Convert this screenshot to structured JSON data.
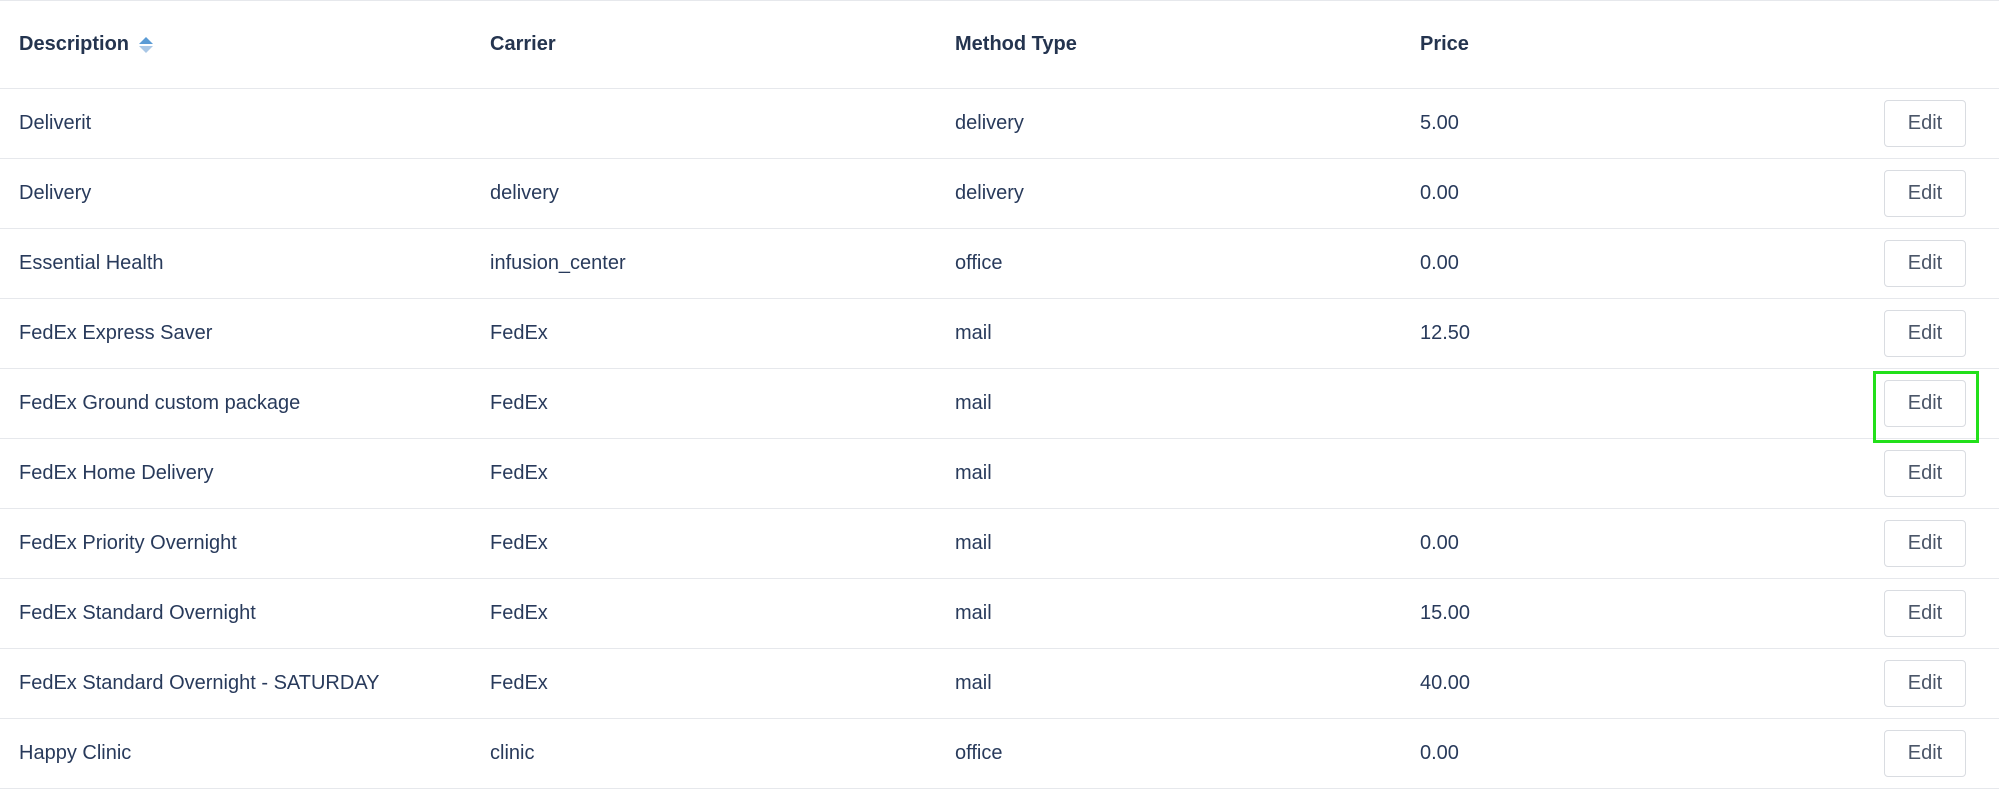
{
  "columns": {
    "description": "Description",
    "carrier": "Carrier",
    "method_type": "Method Type",
    "price": "Price"
  },
  "rows": [
    {
      "description": "Deliverit",
      "carrier": "",
      "method_type": "delivery",
      "price": "5.00",
      "action": "Edit"
    },
    {
      "description": "Delivery",
      "carrier": "delivery",
      "method_type": "delivery",
      "price": "0.00",
      "action": "Edit"
    },
    {
      "description": "Essential Health",
      "carrier": "infusion_center",
      "method_type": "office",
      "price": "0.00",
      "action": "Edit"
    },
    {
      "description": "FedEx Express Saver",
      "carrier": "FedEx",
      "method_type": "mail",
      "price": "12.50",
      "action": "Edit"
    },
    {
      "description": "FedEx Ground custom package",
      "carrier": "FedEx",
      "method_type": "mail",
      "price": "",
      "action": "Edit"
    },
    {
      "description": "FedEx Home Delivery",
      "carrier": "FedEx",
      "method_type": "mail",
      "price": "",
      "action": "Edit"
    },
    {
      "description": "FedEx Priority Overnight",
      "carrier": "FedEx",
      "method_type": "mail",
      "price": "0.00",
      "action": "Edit"
    },
    {
      "description": "FedEx Standard Overnight",
      "carrier": "FedEx",
      "method_type": "mail",
      "price": "15.00",
      "action": "Edit"
    },
    {
      "description": "FedEx Standard Overnight - SATURDAY",
      "carrier": "FedEx",
      "method_type": "mail",
      "price": "40.00",
      "action": "Edit"
    },
    {
      "description": "Happy Clinic",
      "carrier": "clinic",
      "method_type": "office",
      "price": "0.00",
      "action": "Edit"
    }
  ],
  "highlighted_row_index": 4,
  "colors": {
    "text": "#283a5b",
    "border": "#e6e8ec",
    "highlight": "#22e01a",
    "sort_icon": "#5b9bd5"
  }
}
